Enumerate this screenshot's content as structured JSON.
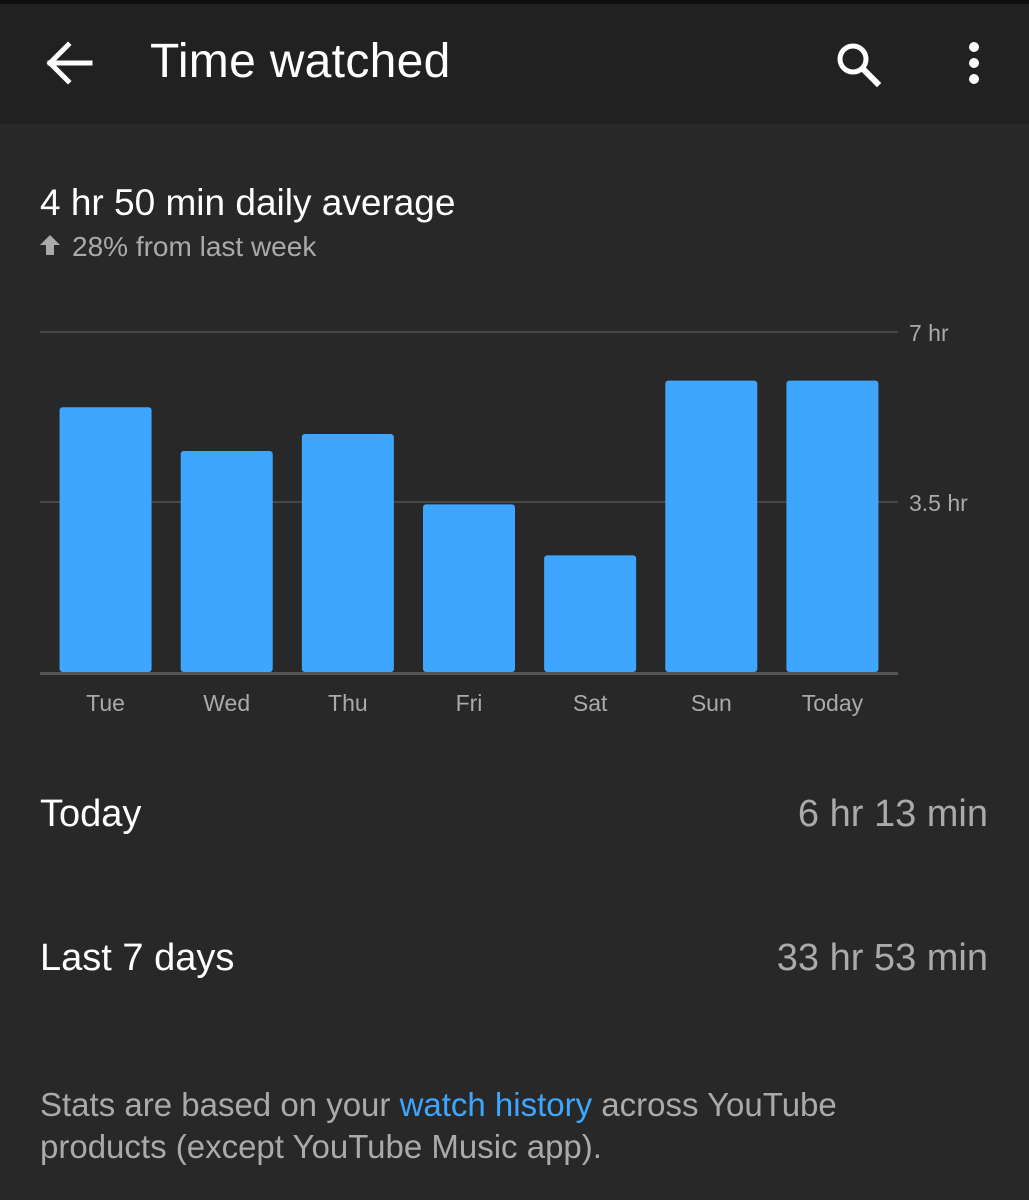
{
  "header": {
    "title": "Time watched",
    "back_icon": "arrow-back-icon",
    "search_icon": "search-icon",
    "more_icon": "more-vert-icon"
  },
  "summary": {
    "daily_average": "4 hr 50 min daily average",
    "change_icon": "arrow-up-icon",
    "change_text": "28% from last week"
  },
  "chart_data": {
    "type": "bar",
    "categories": [
      "Tue",
      "Wed",
      "Thu",
      "Fri",
      "Sat",
      "Sun",
      "Today"
    ],
    "values": [
      5.45,
      4.55,
      4.9,
      3.45,
      2.4,
      6.0,
      6.0
    ],
    "unit": "hr",
    "ylim": [
      0,
      7
    ],
    "yticks": [
      {
        "value": 3.5,
        "label": "3.5 hr"
      },
      {
        "value": 7,
        "label": "7 hr"
      }
    ],
    "grid": true,
    "bar_color": "#3ea6ff"
  },
  "stats": {
    "today_label": "Today",
    "today_value": "6 hr 13 min",
    "week_label": "Last 7 days",
    "week_value": "33 hr 53 min"
  },
  "footer": {
    "text_before": "Stats are based on your ",
    "link_text": "watch history",
    "text_after": " across YouTube products (except YouTube Music app)."
  },
  "colors": {
    "background": "#282828",
    "header_background": "#212121",
    "accent": "#3ea6ff",
    "secondary_text": "#aaaaaa"
  }
}
